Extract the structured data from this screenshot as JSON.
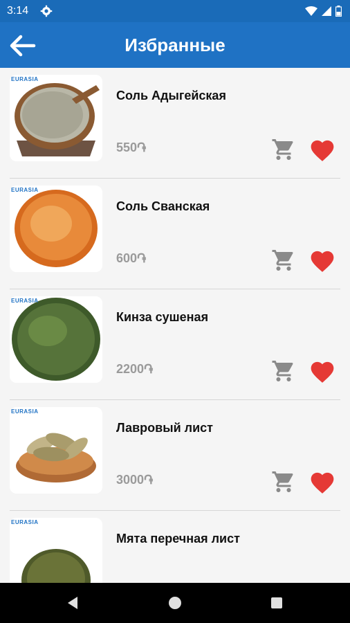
{
  "status": {
    "time": "3:14"
  },
  "header": {
    "title": "Избранные"
  },
  "items": [
    {
      "name": "Соль Адыгейская",
      "price": "550֏",
      "logo": "EURASIA"
    },
    {
      "name": "Соль Сванская",
      "price": "600֏",
      "logo": "EURASIA"
    },
    {
      "name": "Кинза сушеная",
      "price": "2200֏",
      "logo": "EURASIA"
    },
    {
      "name": "Лавровый лист",
      "price": "3000֏",
      "logo": "EURASIA"
    },
    {
      "name": "Мята перечная лист",
      "price": "",
      "logo": "EURASIA"
    }
  ],
  "colors": {
    "primary": "#1f72c4",
    "status": "#1a6bb8",
    "heart": "#e53935",
    "cart": "#8a8a8a"
  }
}
